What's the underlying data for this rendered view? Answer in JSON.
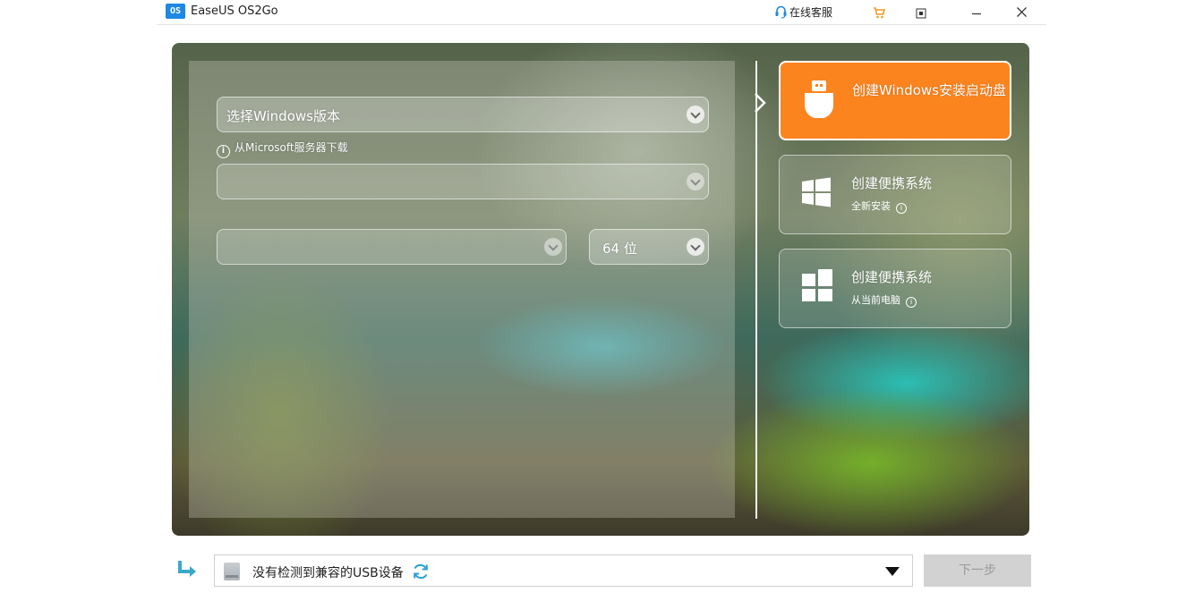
{
  "window": {
    "app_logo_text": "OS",
    "app_title": "EaseUS OS2Go",
    "support_label": "在线客服",
    "icons": [
      "support-headset-icon",
      "cart-icon",
      "restore-icon",
      "minimize-icon",
      "close-icon"
    ]
  },
  "form": {
    "windows_version_placeholder": "选择Windows版本",
    "download_note": "从Microsoft服务器下载",
    "language_value": "",
    "edition_value": "",
    "architecture_value": "64 位"
  },
  "options": [
    {
      "title": "创建Windows安装启动盘",
      "subtitle": "",
      "icon": "usb-drive-icon",
      "selected": true
    },
    {
      "title": "创建便携系统",
      "subtitle": "全新安装",
      "icon": "windows-logo-icon",
      "selected": false
    },
    {
      "title": "创建便携系统",
      "subtitle": "从当前电脑",
      "icon": "windows-tiles-icon",
      "selected": false
    }
  ],
  "bottom": {
    "device_status": "没有检测到兼容的USB设备",
    "next_label": "下一步"
  },
  "colors": {
    "accent": "#fb841f",
    "logo_blue": "#1e88e5",
    "refresh_blue": "#2a9fd8",
    "next_disabled": "#d2d2d2"
  }
}
